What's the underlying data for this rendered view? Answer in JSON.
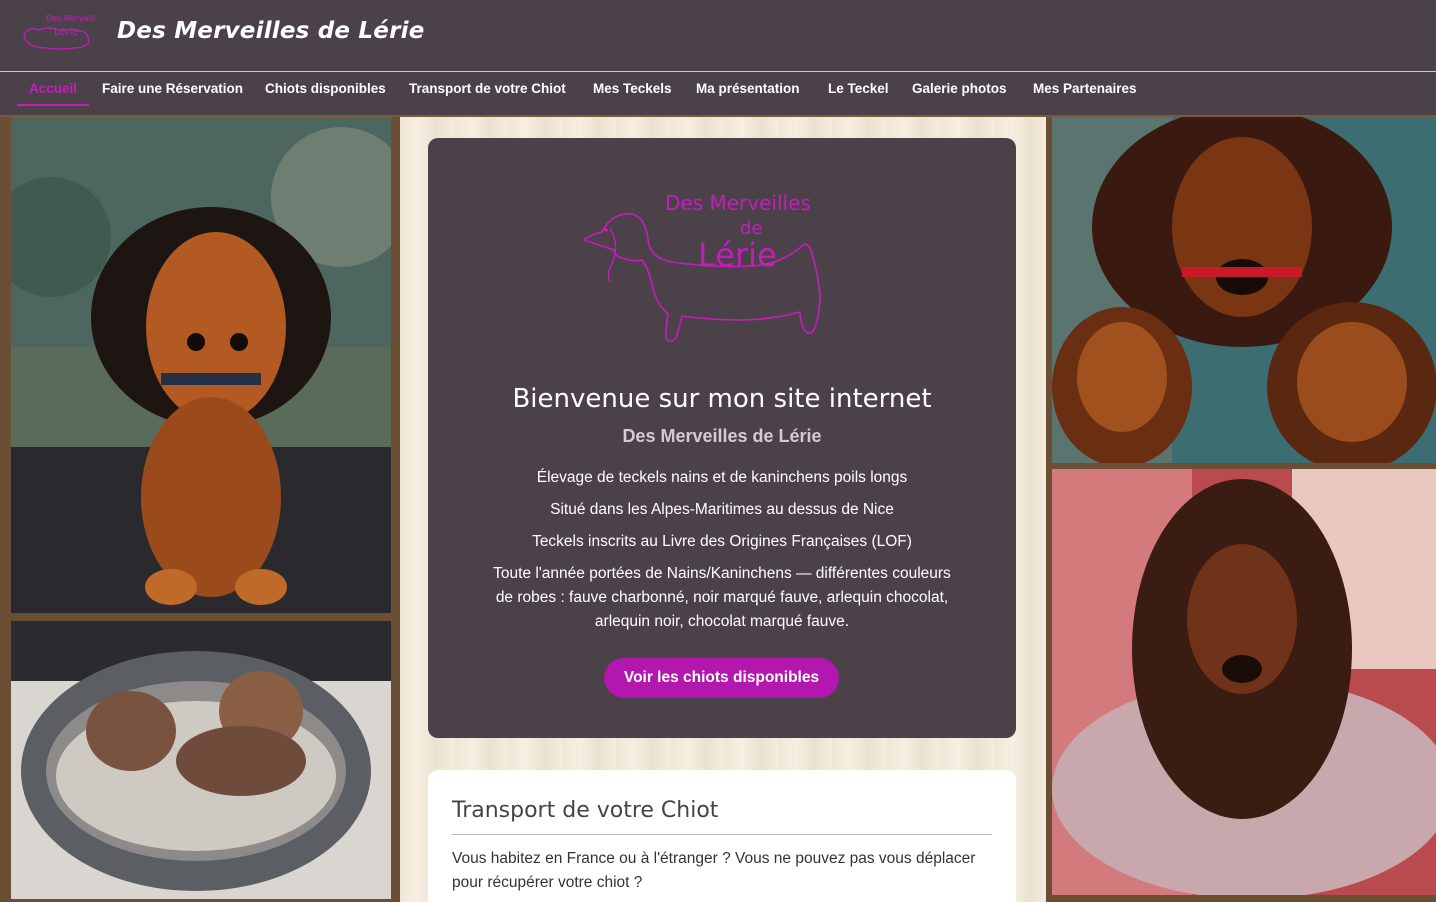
{
  "header": {
    "logo_text_top": "Des Merveilles",
    "logo_text_bottom": "Lérie",
    "site_title": "Des Merveilles de Lérie"
  },
  "nav": {
    "items": [
      {
        "label": "Accueil",
        "active": true
      },
      {
        "label": "Faire une Réservation",
        "active": false
      },
      {
        "label": "Chiots disponibles",
        "active": false
      },
      {
        "label": "Transport de votre Chiot",
        "active": false
      },
      {
        "label": "Mes Teckels",
        "active": false
      },
      {
        "label": "Ma présentation",
        "active": false
      },
      {
        "label": "Le Teckel",
        "active": false
      },
      {
        "label": "Galerie photos",
        "active": false
      },
      {
        "label": "Mes Partenaires",
        "active": false
      }
    ]
  },
  "hero": {
    "logo_line1": "Des Merveilles",
    "logo_line2": "de",
    "logo_line3": "Lérie",
    "welcome": "Bienvenue sur mon site internet",
    "subtitle": "Des Merveilles de Lérie",
    "lines": [
      "Élevage de teckels nains et de kaninchens poils longs",
      "Situé dans les Alpes-Maritimes au dessus de Nice",
      "Teckels inscrits au Livre des Origines Françaises (LOF)",
      "Toute l'année portées de Nains/Kaninchens — différentes couleurs de robes : fauve charbonné, noir marqué fauve, arlequin chocolat, arlequin noir, chocolat marqué fauve."
    ],
    "cta_label": "Voir les chiots disponibles"
  },
  "transport": {
    "title": "Transport de votre Chiot",
    "text": "Vous habitez en France ou à l'étranger ? Vous ne pouvez pas vous déplacer pour récupérer votre chiot ?"
  },
  "colors": {
    "header_bg": "#4b4249",
    "accent": "#c71bbd",
    "button": "#b317ad",
    "card_bg": "#4b4249"
  },
  "photos": {
    "left_top": "dachshund-portrait-photo",
    "left_bottom": "puppies-in-basket-photo",
    "right_top": "dachshund-family-photo",
    "right_bottom": "dachshund-on-cushion-photo"
  }
}
